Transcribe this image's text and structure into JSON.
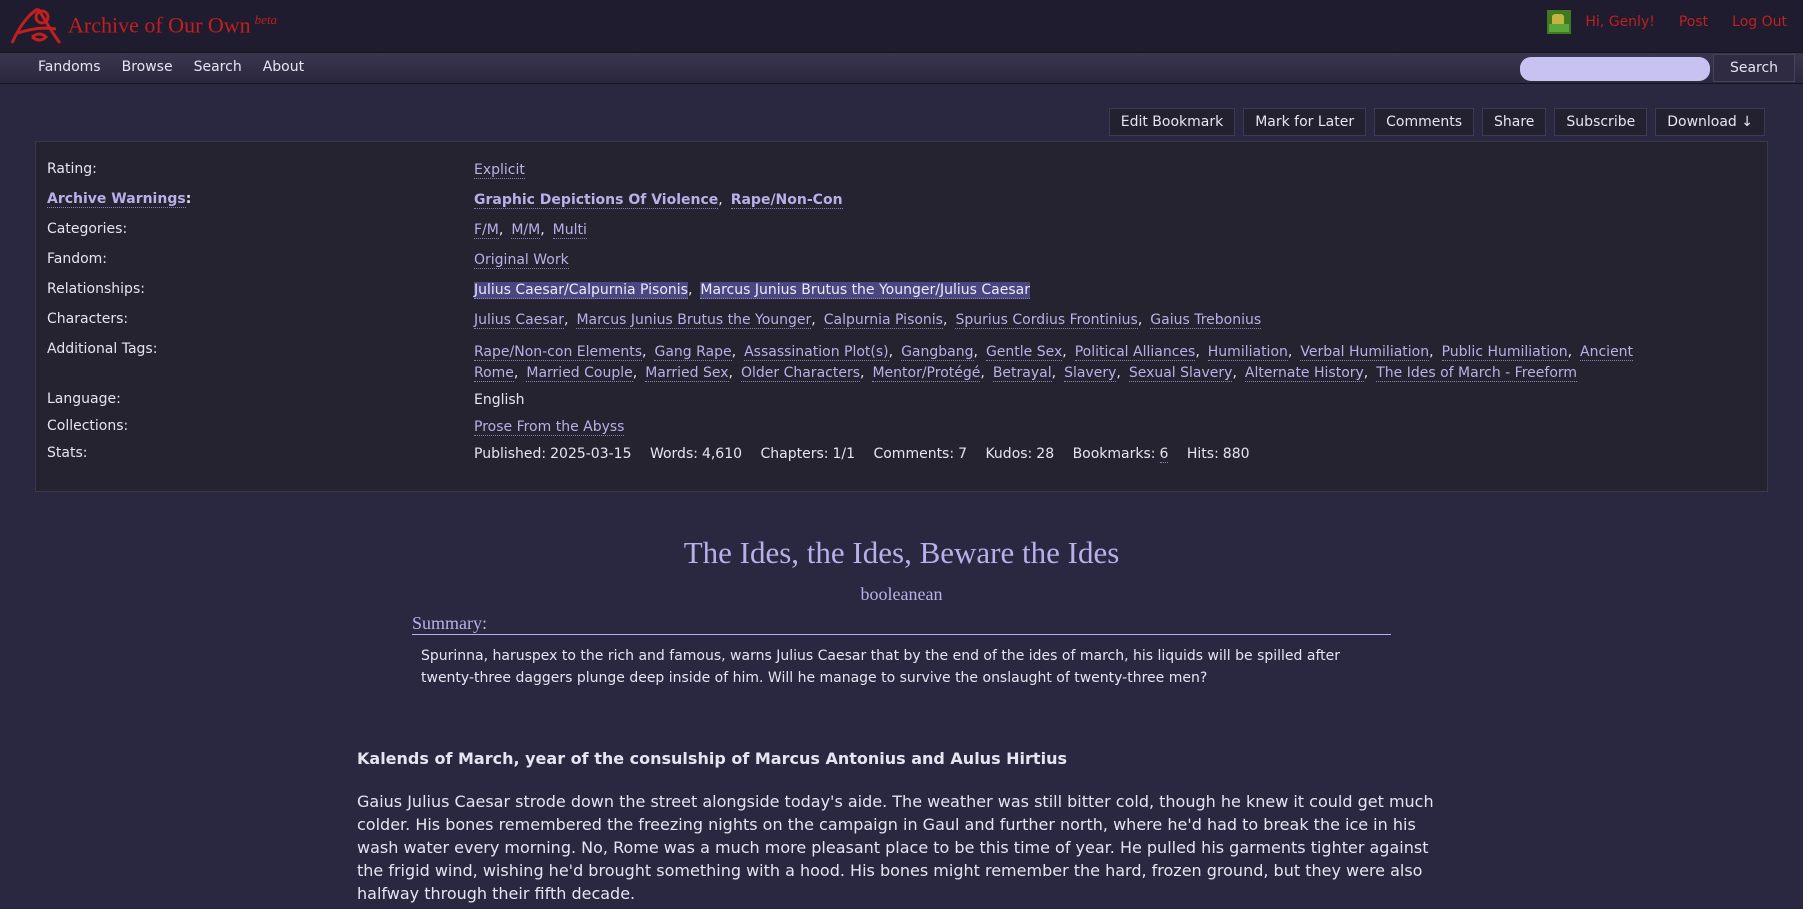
{
  "header": {
    "site_title": "Archive of Our Own",
    "beta": "beta",
    "greeting": "Hi, Genly!",
    "post": "Post",
    "logout": "Log Out",
    "brand_color": "#c0201f"
  },
  "nav": {
    "items": [
      "Fandoms",
      "Browse",
      "Search",
      "About"
    ],
    "search_button": "Search",
    "search_placeholder": ""
  },
  "actions": [
    "Edit Bookmark",
    "Mark for Later",
    "Comments",
    "Share",
    "Subscribe",
    "Download ↓"
  ],
  "meta": {
    "rating_label": "Rating:",
    "rating": "Explicit",
    "warnings_label": "Archive Warnings",
    "warnings": [
      "Graphic Depictions Of Violence",
      "Rape/Non-Con"
    ],
    "categories_label": "Categories:",
    "categories": [
      "F/M",
      "M/M",
      "Multi"
    ],
    "fandom_label": "Fandom:",
    "fandom": "Original Work",
    "relationships_label": "Relationships:",
    "relationships": [
      "Julius Caesar/Calpurnia Pisonis",
      "Marcus Junius Brutus the Younger/Julius Caesar"
    ],
    "characters_label": "Characters:",
    "characters": [
      "Julius Caesar",
      "Marcus Junius Brutus the Younger",
      "Calpurnia Pisonis",
      "Spurius Cordius Frontinius",
      "Gaius Trebonius"
    ],
    "additional_tags_label": "Additional Tags:",
    "additional_tags": [
      "Rape/Non-con Elements",
      "Gang Rape",
      "Assassination Plot(s)",
      "Gangbang",
      "Gentle Sex",
      "Political Alliances",
      "Humiliation",
      "Verbal Humiliation",
      "Public Humiliation",
      "Ancient Rome",
      "Married Couple",
      "Married Sex",
      "Older Characters",
      "Mentor/Protégé",
      "Betrayal",
      "Slavery",
      "Sexual Slavery",
      "Alternate History",
      "The Ides of March - Freeform"
    ],
    "language_label": "Language:",
    "language": "English",
    "collections_label": "Collections:",
    "collections": "Prose From the Abyss",
    "stats_label": "Stats:",
    "stats": {
      "published_label": "Published:",
      "published": "2025-03-15",
      "words_label": "Words:",
      "words": "4,610",
      "chapters_label": "Chapters:",
      "chapters": "1/1",
      "comments_label": "Comments:",
      "comments": "7",
      "kudos_label": "Kudos:",
      "kudos": "28",
      "bookmarks_label": "Bookmarks:",
      "bookmarks": "6",
      "hits_label": "Hits:",
      "hits": "880"
    }
  },
  "work": {
    "title": "The Ides, the Ides, Beware the Ides",
    "author": "booleanean",
    "summary_heading": "Summary:",
    "summary": "Spurinna, haruspex to the rich and famous, warns Julius Caesar that by the end of the ides of march, his liquids will be spilled after twenty-three daggers plunge deep inside of him. Will he manage to survive the onslaught of twenty-three men?",
    "chapter_heading": "Kalends of March, year of the consulship of Marcus Antonius and Aulus Hirtius",
    "body": "Gaius Julius Caesar strode down the street alongside today's aide. The weather was still bitter cold, though he knew it could get much colder. His bones remembered the freezing nights on the campaign in Gaul and further north, where he'd had to break the ice in his wash water every morning. No, Rome was a much more pleasant place to be this time of year. He pulled his garments tighter against the frigid wind, wishing he'd brought something with a hood. His bones might remember the hard, frozen ground, but they were also halfway through their fifth decade."
  }
}
